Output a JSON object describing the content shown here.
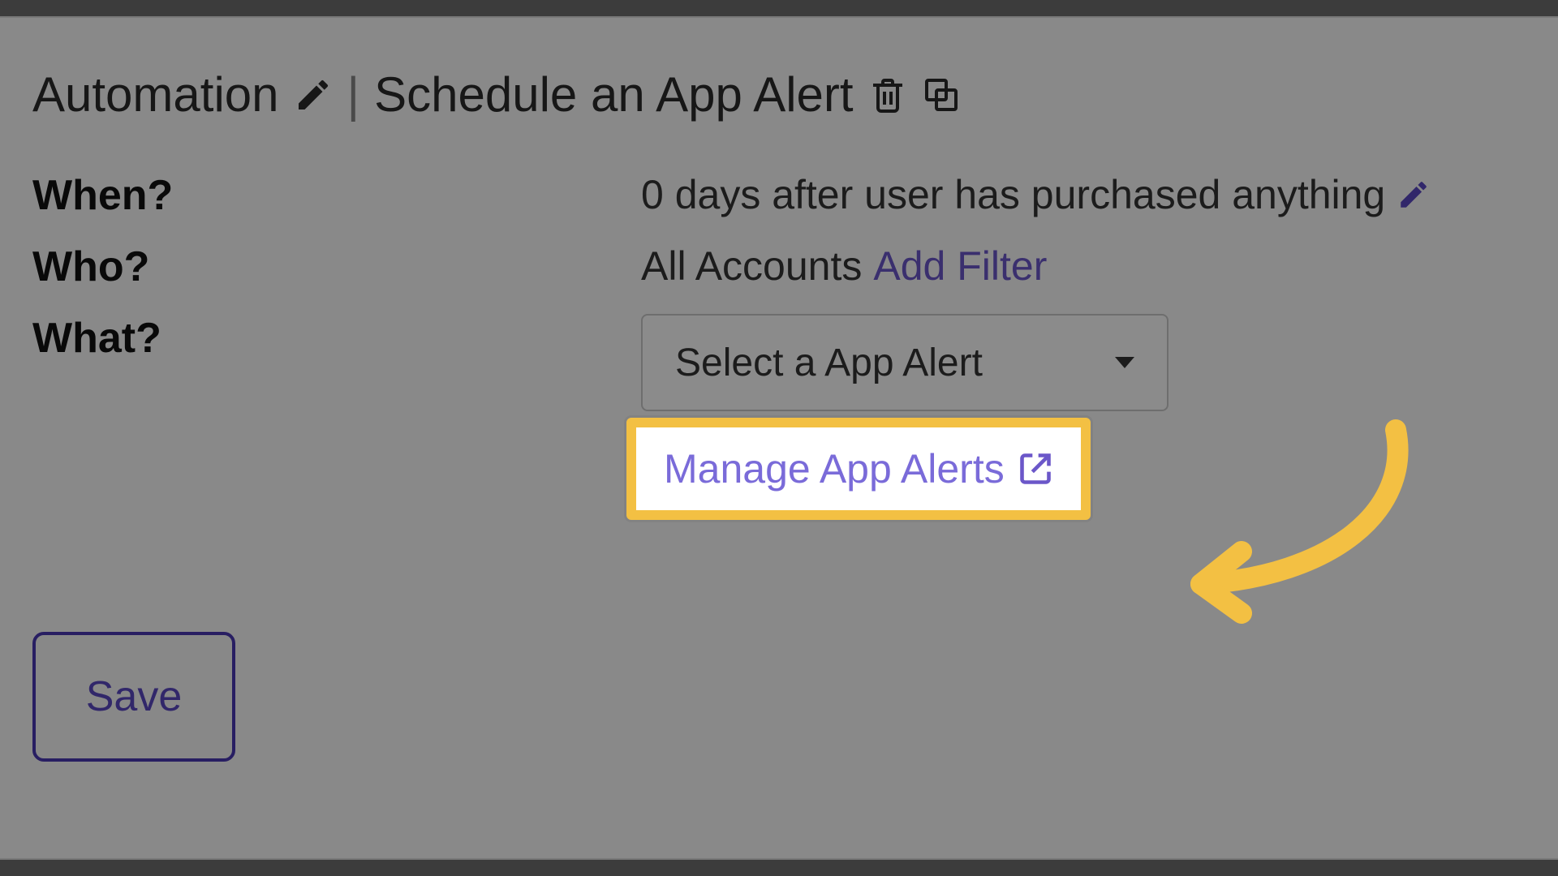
{
  "title": {
    "automation_label": "Automation",
    "subtitle": "Schedule an App Alert"
  },
  "form": {
    "when_label": "When?",
    "when_value": "0 days after user has purchased anything",
    "who_label": "Who?",
    "who_value": "All Accounts",
    "who_add_filter": "Add Filter",
    "what_label": "What?",
    "what_select_placeholder": "Select a App Alert",
    "manage_link": "Manage App Alerts"
  },
  "actions": {
    "save": "Save"
  },
  "colors": {
    "link": "#6b57c9",
    "highlight": "#f3c043",
    "save_border": "#4a37b3"
  }
}
